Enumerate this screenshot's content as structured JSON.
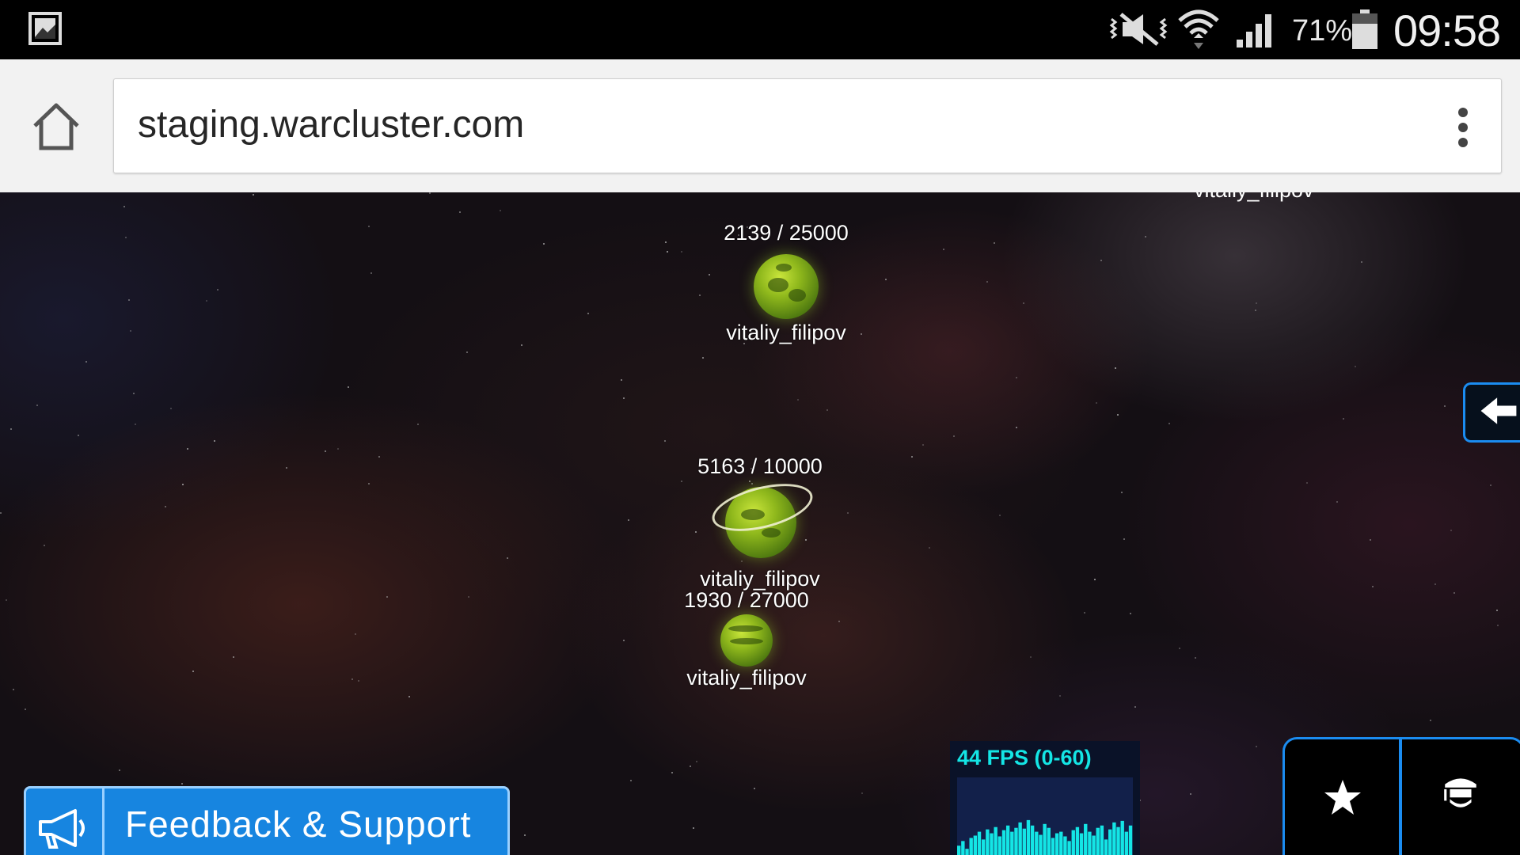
{
  "status_bar": {
    "battery_percent": "71%",
    "time": "09:58",
    "icons": [
      "gallery-icon",
      "mute-vibrate-icon",
      "wifi-icon",
      "signal-icon",
      "battery-icon"
    ]
  },
  "browser": {
    "url": "staging.warcluster.com",
    "icons": [
      "home-icon",
      "overflow-menu-icon"
    ]
  },
  "game": {
    "offscreen_planet_owner": "vitaliy_filipov",
    "planets": [
      {
        "population": "2139 / 25000",
        "owner": "vitaliy_filipov"
      },
      {
        "population": "5163 / 10000",
        "owner": "vitaliy_filipov"
      },
      {
        "population": "1930 / 27000",
        "owner": "vitaliy_filipov"
      }
    ],
    "fps": {
      "label": "44 FPS (0-60)",
      "color": "#14e5e5",
      "history": [
        0.12,
        0.18,
        0.08,
        0.22,
        0.25,
        0.3,
        0.2,
        0.33,
        0.28,
        0.36,
        0.24,
        0.32,
        0.38,
        0.3,
        0.35,
        0.42,
        0.34,
        0.45,
        0.38,
        0.3,
        0.26,
        0.4,
        0.35,
        0.22,
        0.28,
        0.3,
        0.24,
        0.18,
        0.32,
        0.36,
        0.28,
        0.4,
        0.3,
        0.25,
        0.35,
        0.38,
        0.2,
        0.33,
        0.42,
        0.36,
        0.44,
        0.3,
        0.38
      ]
    },
    "feedback_button": {
      "label": "Feedback & Support",
      "icon": "megaphone-icon"
    },
    "hud_buttons": [
      "star-icon",
      "graduation-cap-icon"
    ],
    "side_button_icon": "arrow-left-icon",
    "accent_color": "#1b8cf0"
  }
}
